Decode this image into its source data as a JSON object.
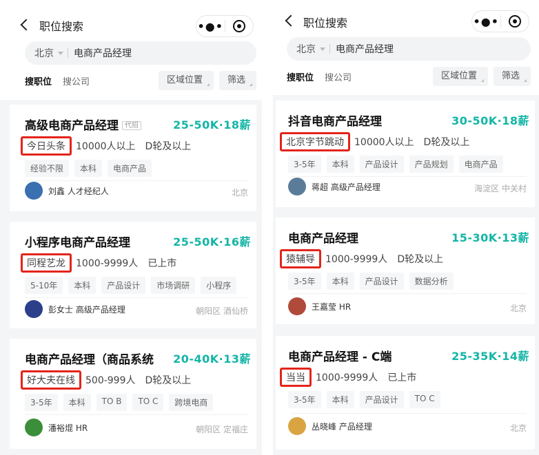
{
  "left": {
    "title": "职位搜索",
    "search": {
      "city": "北京",
      "query": "电商产品经理"
    },
    "tabs": [
      "搜职位",
      "搜公司"
    ],
    "filters": [
      "区域位置",
      "筛选"
    ],
    "jobs": [
      {
        "title": "高级电商产品经理",
        "badge": "代招",
        "salary": "25-50K·18薪",
        "company": "今日头条",
        "size": "10000人以上",
        "stage": "D轮及以上",
        "tags": [
          "经验不限",
          "本科",
          "电商产品"
        ],
        "recruiter": "刘鑫 人才经纪人",
        "location": "北京",
        "avatar_color": "#3a6fb0"
      },
      {
        "title": "小程序电商产品经理",
        "badge": "",
        "salary": "25-50K·16薪",
        "company": "同程艺龙",
        "size": "1000-9999人",
        "stage": "已上市",
        "tags": [
          "5-10年",
          "本科",
          "产品设计",
          "市场调研",
          "小程序"
        ],
        "recruiter": "彭女士 高级产品经理",
        "location": "朝阳区 酒仙桥",
        "avatar_color": "#2b3f8a"
      },
      {
        "title": "电商产品经理（商品系统",
        "badge": "",
        "salary": "20-40K·13薪",
        "company": "好大夫在线",
        "size": "500-999人",
        "stage": "D轮及以上",
        "tags": [
          "3-5年",
          "本科",
          "TO B",
          "TO C",
          "跨境电商"
        ],
        "recruiter": "潘裕焜 HR",
        "location": "朝阳区 定福庄",
        "avatar_color": "#3c8f3a"
      }
    ]
  },
  "right": {
    "title": "职位搜索",
    "search": {
      "city": "北京",
      "query": "电商产品经理"
    },
    "tabs": [
      "搜职位",
      "搜公司"
    ],
    "filters": [
      "区域位置",
      "筛选"
    ],
    "jobs": [
      {
        "title": "抖音电商产品经理",
        "badge": "",
        "salary": "30-50K·18薪",
        "company": "北京字节跳动",
        "size": "10000人以上",
        "stage": "D轮及以上",
        "tags": [
          "3-5年",
          "本科",
          "产品设计",
          "产品规划",
          "电商产品"
        ],
        "recruiter": "蒋超 高级产品经理",
        "location": "海淀区 中关村",
        "avatar_color": "#5b7c99"
      },
      {
        "title": "电商产品经理",
        "badge": "",
        "salary": "15-30K·13薪",
        "company": "猿辅导",
        "size": "1000-9999人",
        "stage": "D轮及以上",
        "tags": [
          "3-5年",
          "本科",
          "产品设计",
          "数据分析"
        ],
        "recruiter": "王嘉莹 HR",
        "location": "北京",
        "avatar_color": "#b04a3a"
      },
      {
        "title": "电商产品经理 - C端",
        "badge": "",
        "salary": "25-35K·14薪",
        "company": "当当",
        "size": "1000-9999人",
        "stage": "已上市",
        "tags": [
          "3-5年",
          "本科",
          "产品设计",
          "TO C"
        ],
        "recruiter": "丛晓峰 产品经理",
        "location": "北京",
        "avatar_color": "#d9a441"
      }
    ]
  }
}
